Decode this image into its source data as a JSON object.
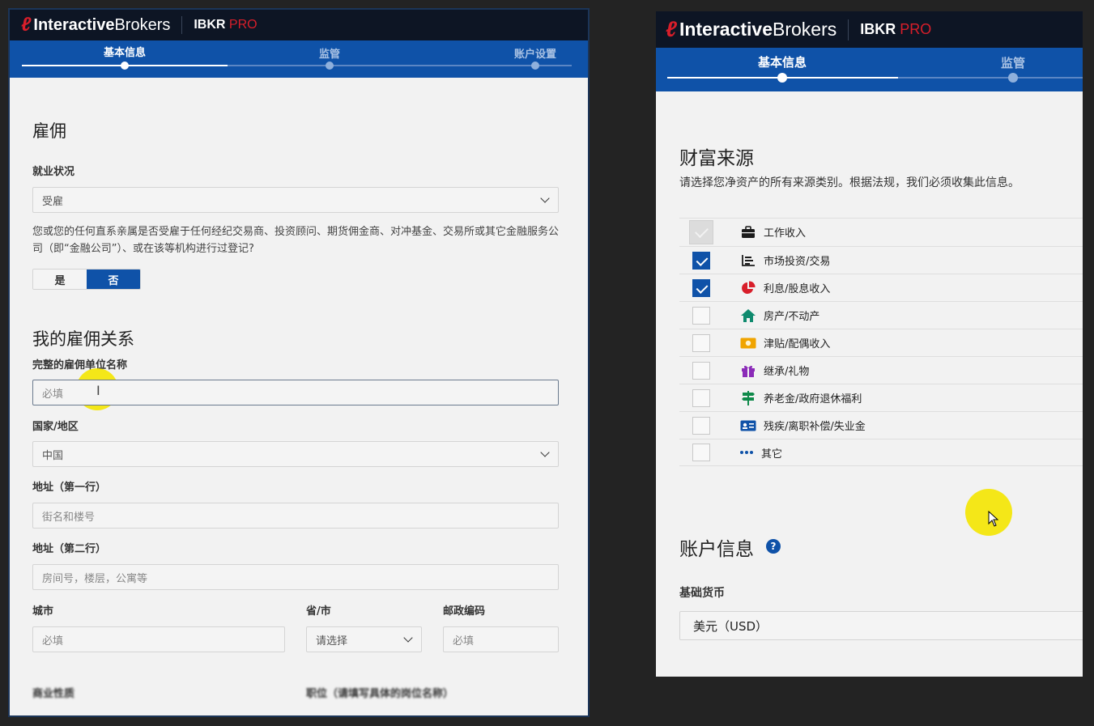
{
  "brand": {
    "logo_mark": "ℓ",
    "logo_bold": "Interactive",
    "logo_light": "Brokers",
    "product": "IBKR",
    "product_suffix": "PRO"
  },
  "colors": {
    "accent": "#0f52a8",
    "header": "#0d1524",
    "brand_red": "#d81e2a",
    "highlight": "#f4e600"
  },
  "left": {
    "steps": [
      "基本信息",
      "监管",
      "账户设置"
    ],
    "employment_title": "雇佣",
    "employment_status_label": "就业状况",
    "employment_status_value": "受雇",
    "affiliation_question": "您或您的任何直系亲属是否受雇于任何经纪交易商、投资顾问、期货佣金商、对冲基金、交易所或其它金融服务公司（即“金融公司”）、或在该等机构进行过登记?",
    "toggle_yes": "是",
    "toggle_no": "否",
    "my_employment_title": "我的雇佣关系",
    "employer_name_label": "完整的雇佣单位名称",
    "employer_name_placeholder": "必填",
    "country_label": "国家/地区",
    "country_value": "中国",
    "address1_label": "地址（第一行）",
    "address1_placeholder": "街名和楼号",
    "address2_label": "地址（第二行）",
    "address2_placeholder": "房间号，楼层，公寓等",
    "city_label": "城市",
    "city_placeholder": "必填",
    "province_label": "省/市",
    "province_value": "请选择",
    "postal_label": "邮政编码",
    "postal_placeholder": "必填",
    "business_label": "商业性质",
    "position_label": "职位（请填写具体的岗位名称）"
  },
  "right": {
    "steps": [
      "基本信息",
      "监管"
    ],
    "wealth_title": "财富来源",
    "wealth_desc": "请选择您净资产的所有来源类别。根据法规，我们必须收集此信息。",
    "sources": [
      {
        "label": "工作收入",
        "state": "disabled",
        "icon": "briefcase-icon",
        "color": "#1b1b1b"
      },
      {
        "label": "市场投资/交易",
        "state": "checked",
        "icon": "chart-icon",
        "color": "#1b1b1b"
      },
      {
        "label": "利息/股息收入",
        "state": "checked",
        "icon": "pie-icon",
        "color": "#d81e2a"
      },
      {
        "label": "房产/不动产",
        "state": "unchecked",
        "icon": "house-icon",
        "color": "#0f8a6e"
      },
      {
        "label": "津贴/配偶收入",
        "state": "unchecked",
        "icon": "money-icon",
        "color": "#f0a400"
      },
      {
        "label": "继承/礼物",
        "state": "unchecked",
        "icon": "gift-icon",
        "color": "#8b2bb8"
      },
      {
        "label": "养老金/政府退休福利",
        "state": "unchecked",
        "icon": "signpost-icon",
        "color": "#0f8a4a"
      },
      {
        "label": "残疾/离职补偿/失业金",
        "state": "unchecked",
        "icon": "id-card-icon",
        "color": "#0f52a8"
      },
      {
        "label": "其它",
        "state": "unchecked",
        "icon": "more-icon",
        "color": "#0f52a8"
      }
    ],
    "account_info_title": "账户信息",
    "base_currency_label": "基础货币",
    "base_currency_value": "美元（USD）"
  }
}
